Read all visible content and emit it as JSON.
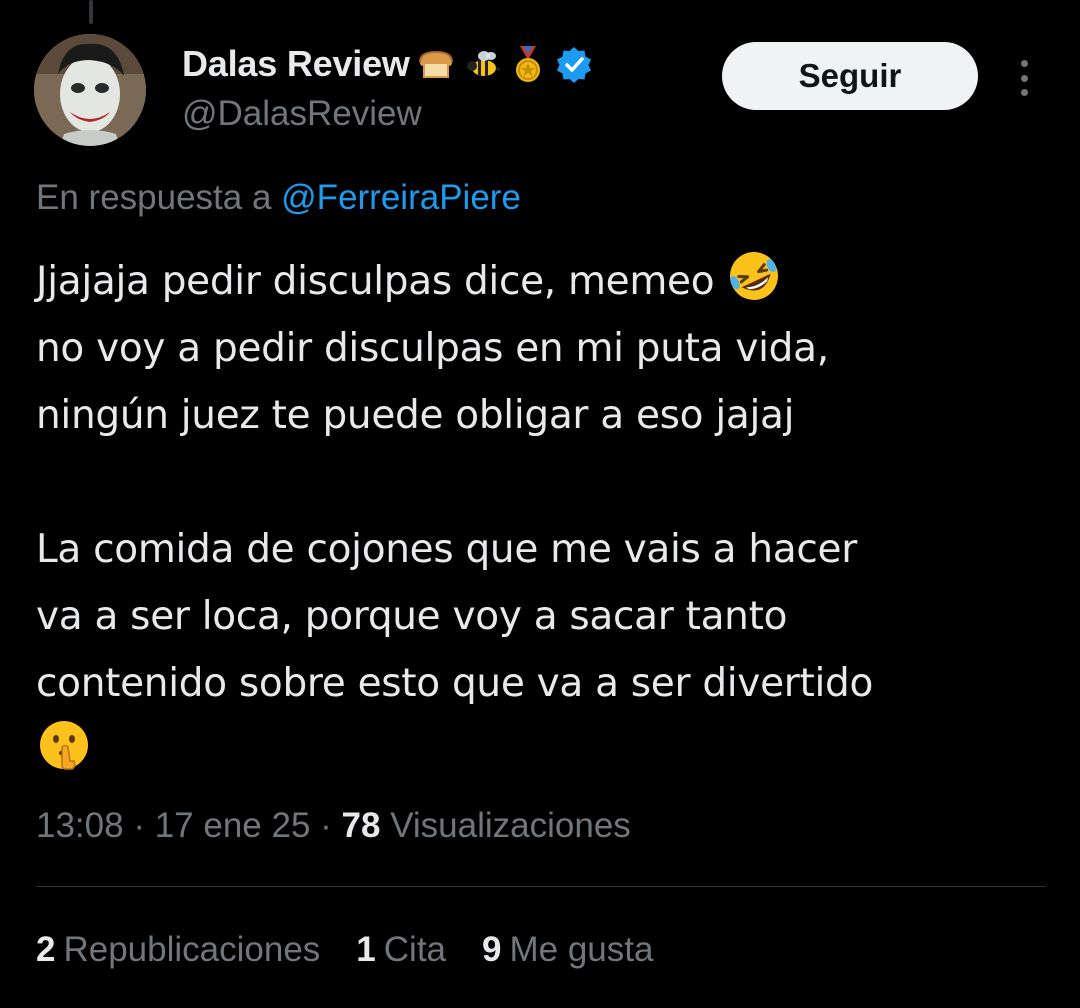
{
  "author": {
    "display_name": "Dalas Review",
    "handle": "@DalasReview",
    "badges": [
      "bread-emoji-icon",
      "bee-emoji-icon",
      "medal-emoji-icon",
      "verified-badge-icon"
    ],
    "verified_color": "#1d9bf0"
  },
  "actions": {
    "follow_label": "Seguir",
    "more_icon": "more-options-icon"
  },
  "reply": {
    "prefix": "En respuesta a ",
    "mention": "@FerreiraPiere",
    "mention_color": "#1d9bf0"
  },
  "tweet": {
    "lines": [
      "Jjajaja pedir disculpas dice, memeo",
      "no voy a pedir disculpas en mi puta vida,",
      "ningún juez te puede obligar a eso jajaj",
      "La comida de cojones que me vais a hacer",
      "va a ser loca, porque voy a sacar tanto",
      "contenido sobre esto que va a ser divertido"
    ],
    "emoji_after_line1": "rolling-on-floor-laughing-emoji-icon",
    "emoji_final": "shushing-face-emoji-icon"
  },
  "meta": {
    "time": "13:08",
    "sep1": " · ",
    "date": "17 ene 25",
    "sep2": " · ",
    "views_count": "78",
    "views_label": " Visualizaciones"
  },
  "stats": {
    "reposts_count": "2",
    "reposts_label": "Republicaciones",
    "quotes_count": "1",
    "quotes_label": "Cita",
    "likes_count": "9",
    "likes_label": "Me gusta"
  },
  "colors": {
    "background": "#000000",
    "text": "#e7e9ea",
    "secondary": "#71767b",
    "accent": "#1d9bf0",
    "button_bg": "#eff3f4"
  }
}
